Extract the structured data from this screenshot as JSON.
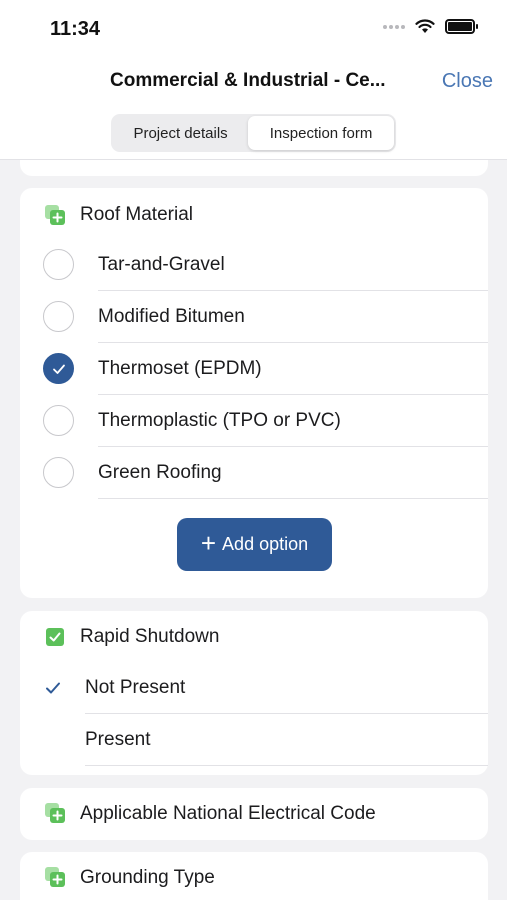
{
  "status_bar": {
    "time": "11:34"
  },
  "nav": {
    "title": "Commercial & Industrial - Ce...",
    "close_label": "Close",
    "tabs": [
      {
        "label": "Project details",
        "active": false
      },
      {
        "label": "Inspection form",
        "active": true
      }
    ]
  },
  "roof_material": {
    "title": "Roof Material",
    "options": [
      {
        "label": "Tar-and-Gravel",
        "selected": false
      },
      {
        "label": "Modified Bitumen",
        "selected": false
      },
      {
        "label": "Thermoset (EPDM)",
        "selected": true
      },
      {
        "label": "Thermoplastic (TPO or PVC)",
        "selected": false
      },
      {
        "label": "Green Roofing",
        "selected": false
      }
    ],
    "add_option_label": "Add option"
  },
  "rapid_shutdown": {
    "title": "Rapid Shutdown",
    "options": [
      {
        "label": "Not Present",
        "selected": true
      },
      {
        "label": "Present",
        "selected": false
      }
    ]
  },
  "applicable_nec": {
    "title": "Applicable National Electrical Code"
  },
  "grounding_type": {
    "title": "Grounding Type"
  },
  "colors": {
    "accent": "#2f5a97",
    "link": "#4a77b4",
    "section_icon": "#5cc05a",
    "background": "#f2f2f4"
  },
  "icons": {
    "section": "add-square-icon",
    "checked_section": "checkbox-checked-icon",
    "selected_radio": "check-circle-icon",
    "selected_check": "checkmark-icon"
  }
}
